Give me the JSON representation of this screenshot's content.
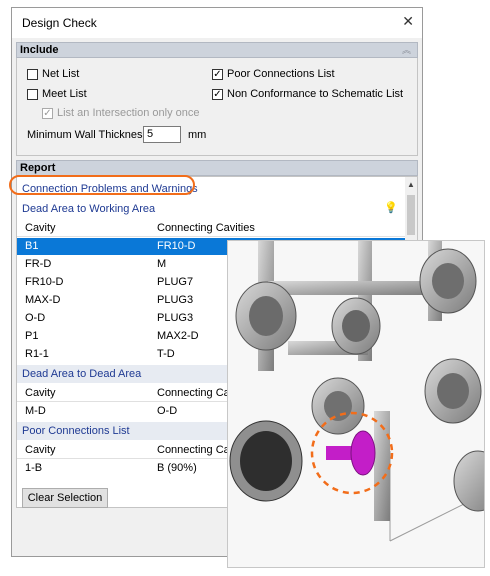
{
  "window": {
    "title": "Design Check",
    "close_glyph": "✕"
  },
  "include": {
    "header": "Include",
    "collapse_glyph": "︽",
    "options": {
      "net_list": {
        "label": "Net List",
        "checked": false
      },
      "meet_list": {
        "label": "Meet List",
        "checked": false
      },
      "intersection_once": {
        "label": "List an Intersection only once",
        "checked": true,
        "enabled": false
      },
      "poor_connections": {
        "label": "Poor Connections List",
        "checked": true
      },
      "non_conformance": {
        "label": "Non Conformance to Schematic List",
        "checked": true
      }
    },
    "min_wall": {
      "label": "Minimum Wall Thickness",
      "value": "5",
      "unit": "mm"
    }
  },
  "report": {
    "header": "Report",
    "top_group": "Connection Problems and Warnings",
    "col_cavity": "Cavity",
    "col_connecting": "Connecting Cavities",
    "col_connecting_truncated": "Connecting Ca",
    "groups": {
      "dead_to_working": {
        "label": "Dead Area to Working Area",
        "rows": [
          {
            "cavity": "B1",
            "connecting": "FR10-D"
          },
          {
            "cavity": "FR-D",
            "connecting": "M"
          },
          {
            "cavity": "FR10-D",
            "connecting": "PLUG7"
          },
          {
            "cavity": "MAX-D",
            "connecting": "PLUG3"
          },
          {
            "cavity": "O-D",
            "connecting": "PLUG3"
          },
          {
            "cavity": "P1",
            "connecting": "MAX2-D"
          },
          {
            "cavity": "R1-1",
            "connecting": "T-D"
          }
        ]
      },
      "dead_to_dead": {
        "label": "Dead Area to Dead Area",
        "rows": [
          {
            "cavity": "M-D",
            "connecting": "O-D"
          }
        ]
      },
      "poor_connections": {
        "label": "Poor Connections List",
        "rows": [
          {
            "cavity": "1-B",
            "connecting": "B (90%)"
          }
        ]
      }
    }
  },
  "buttons": {
    "clear_selection": "Clear Selection"
  },
  "colors": {
    "selection": "#0a78d7",
    "highlight_ring": "#f26d1a",
    "problem_part": "#c31ec8"
  }
}
